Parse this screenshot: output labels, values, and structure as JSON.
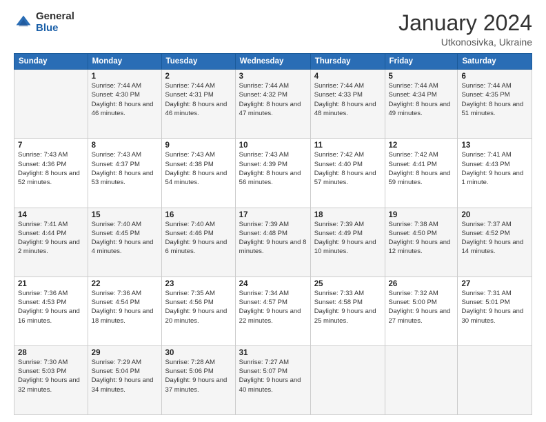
{
  "logo": {
    "general": "General",
    "blue": "Blue"
  },
  "header": {
    "month_year": "January 2024",
    "location": "Utkonosivka, Ukraine"
  },
  "weekdays": [
    "Sunday",
    "Monday",
    "Tuesday",
    "Wednesday",
    "Thursday",
    "Friday",
    "Saturday"
  ],
  "weeks": [
    [
      {
        "num": "",
        "sunrise": "",
        "sunset": "",
        "daylight": ""
      },
      {
        "num": "1",
        "sunrise": "Sunrise: 7:44 AM",
        "sunset": "Sunset: 4:30 PM",
        "daylight": "Daylight: 8 hours and 46 minutes."
      },
      {
        "num": "2",
        "sunrise": "Sunrise: 7:44 AM",
        "sunset": "Sunset: 4:31 PM",
        "daylight": "Daylight: 8 hours and 46 minutes."
      },
      {
        "num": "3",
        "sunrise": "Sunrise: 7:44 AM",
        "sunset": "Sunset: 4:32 PM",
        "daylight": "Daylight: 8 hours and 47 minutes."
      },
      {
        "num": "4",
        "sunrise": "Sunrise: 7:44 AM",
        "sunset": "Sunset: 4:33 PM",
        "daylight": "Daylight: 8 hours and 48 minutes."
      },
      {
        "num": "5",
        "sunrise": "Sunrise: 7:44 AM",
        "sunset": "Sunset: 4:34 PM",
        "daylight": "Daylight: 8 hours and 49 minutes."
      },
      {
        "num": "6",
        "sunrise": "Sunrise: 7:44 AM",
        "sunset": "Sunset: 4:35 PM",
        "daylight": "Daylight: 8 hours and 51 minutes."
      }
    ],
    [
      {
        "num": "7",
        "sunrise": "Sunrise: 7:43 AM",
        "sunset": "Sunset: 4:36 PM",
        "daylight": "Daylight: 8 hours and 52 minutes."
      },
      {
        "num": "8",
        "sunrise": "Sunrise: 7:43 AM",
        "sunset": "Sunset: 4:37 PM",
        "daylight": "Daylight: 8 hours and 53 minutes."
      },
      {
        "num": "9",
        "sunrise": "Sunrise: 7:43 AM",
        "sunset": "Sunset: 4:38 PM",
        "daylight": "Daylight: 8 hours and 54 minutes."
      },
      {
        "num": "10",
        "sunrise": "Sunrise: 7:43 AM",
        "sunset": "Sunset: 4:39 PM",
        "daylight": "Daylight: 8 hours and 56 minutes."
      },
      {
        "num": "11",
        "sunrise": "Sunrise: 7:42 AM",
        "sunset": "Sunset: 4:40 PM",
        "daylight": "Daylight: 8 hours and 57 minutes."
      },
      {
        "num": "12",
        "sunrise": "Sunrise: 7:42 AM",
        "sunset": "Sunset: 4:41 PM",
        "daylight": "Daylight: 8 hours and 59 minutes."
      },
      {
        "num": "13",
        "sunrise": "Sunrise: 7:41 AM",
        "sunset": "Sunset: 4:43 PM",
        "daylight": "Daylight: 9 hours and 1 minute."
      }
    ],
    [
      {
        "num": "14",
        "sunrise": "Sunrise: 7:41 AM",
        "sunset": "Sunset: 4:44 PM",
        "daylight": "Daylight: 9 hours and 2 minutes."
      },
      {
        "num": "15",
        "sunrise": "Sunrise: 7:40 AM",
        "sunset": "Sunset: 4:45 PM",
        "daylight": "Daylight: 9 hours and 4 minutes."
      },
      {
        "num": "16",
        "sunrise": "Sunrise: 7:40 AM",
        "sunset": "Sunset: 4:46 PM",
        "daylight": "Daylight: 9 hours and 6 minutes."
      },
      {
        "num": "17",
        "sunrise": "Sunrise: 7:39 AM",
        "sunset": "Sunset: 4:48 PM",
        "daylight": "Daylight: 9 hours and 8 minutes."
      },
      {
        "num": "18",
        "sunrise": "Sunrise: 7:39 AM",
        "sunset": "Sunset: 4:49 PM",
        "daylight": "Daylight: 9 hours and 10 minutes."
      },
      {
        "num": "19",
        "sunrise": "Sunrise: 7:38 AM",
        "sunset": "Sunset: 4:50 PM",
        "daylight": "Daylight: 9 hours and 12 minutes."
      },
      {
        "num": "20",
        "sunrise": "Sunrise: 7:37 AM",
        "sunset": "Sunset: 4:52 PM",
        "daylight": "Daylight: 9 hours and 14 minutes."
      }
    ],
    [
      {
        "num": "21",
        "sunrise": "Sunrise: 7:36 AM",
        "sunset": "Sunset: 4:53 PM",
        "daylight": "Daylight: 9 hours and 16 minutes."
      },
      {
        "num": "22",
        "sunrise": "Sunrise: 7:36 AM",
        "sunset": "Sunset: 4:54 PM",
        "daylight": "Daylight: 9 hours and 18 minutes."
      },
      {
        "num": "23",
        "sunrise": "Sunrise: 7:35 AM",
        "sunset": "Sunset: 4:56 PM",
        "daylight": "Daylight: 9 hours and 20 minutes."
      },
      {
        "num": "24",
        "sunrise": "Sunrise: 7:34 AM",
        "sunset": "Sunset: 4:57 PM",
        "daylight": "Daylight: 9 hours and 22 minutes."
      },
      {
        "num": "25",
        "sunrise": "Sunrise: 7:33 AM",
        "sunset": "Sunset: 4:58 PM",
        "daylight": "Daylight: 9 hours and 25 minutes."
      },
      {
        "num": "26",
        "sunrise": "Sunrise: 7:32 AM",
        "sunset": "Sunset: 5:00 PM",
        "daylight": "Daylight: 9 hours and 27 minutes."
      },
      {
        "num": "27",
        "sunrise": "Sunrise: 7:31 AM",
        "sunset": "Sunset: 5:01 PM",
        "daylight": "Daylight: 9 hours and 30 minutes."
      }
    ],
    [
      {
        "num": "28",
        "sunrise": "Sunrise: 7:30 AM",
        "sunset": "Sunset: 5:03 PM",
        "daylight": "Daylight: 9 hours and 32 minutes."
      },
      {
        "num": "29",
        "sunrise": "Sunrise: 7:29 AM",
        "sunset": "Sunset: 5:04 PM",
        "daylight": "Daylight: 9 hours and 34 minutes."
      },
      {
        "num": "30",
        "sunrise": "Sunrise: 7:28 AM",
        "sunset": "Sunset: 5:06 PM",
        "daylight": "Daylight: 9 hours and 37 minutes."
      },
      {
        "num": "31",
        "sunrise": "Sunrise: 7:27 AM",
        "sunset": "Sunset: 5:07 PM",
        "daylight": "Daylight: 9 hours and 40 minutes."
      },
      {
        "num": "",
        "sunrise": "",
        "sunset": "",
        "daylight": ""
      },
      {
        "num": "",
        "sunrise": "",
        "sunset": "",
        "daylight": ""
      },
      {
        "num": "",
        "sunrise": "",
        "sunset": "",
        "daylight": ""
      }
    ]
  ]
}
